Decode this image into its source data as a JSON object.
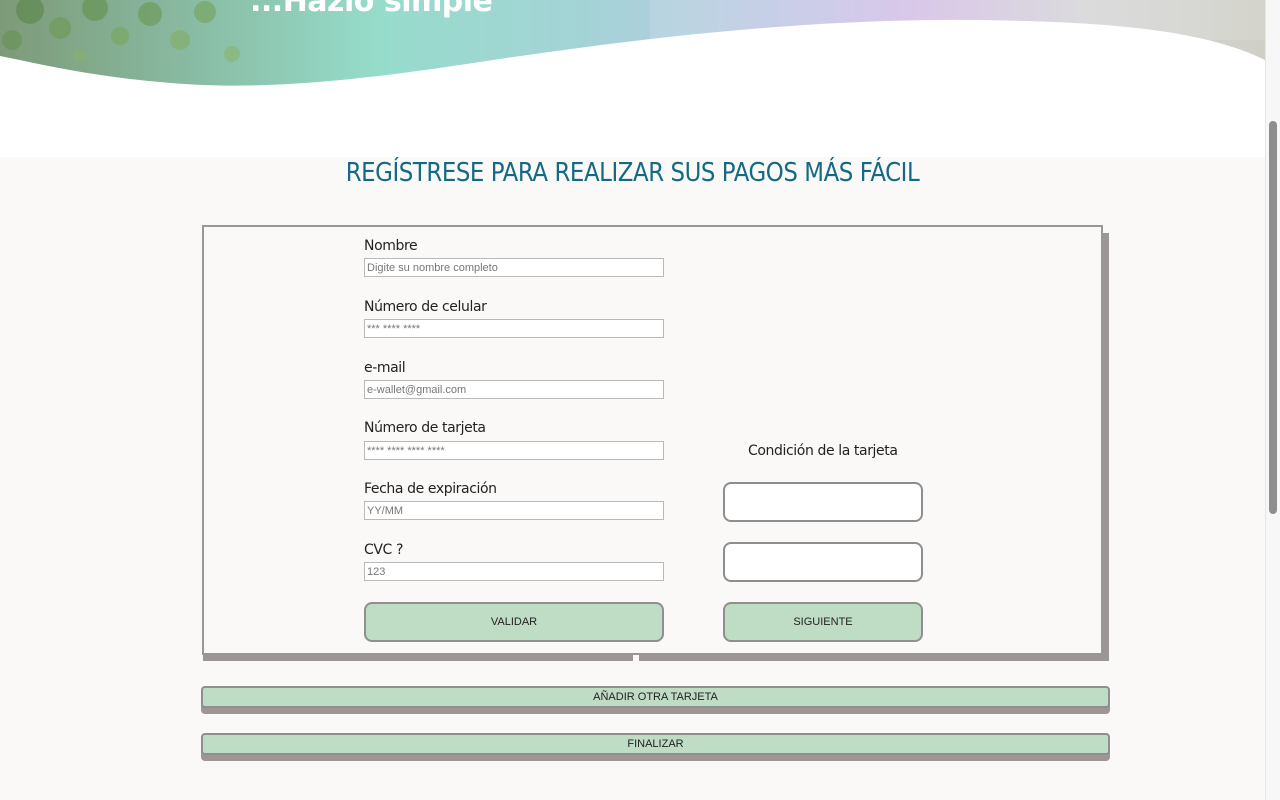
{
  "hero": {
    "tagline": "...Hazlo simple"
  },
  "section": {
    "title": "REGÍSTRESE PARA REALIZAR SUS PAGOS MÁS FÁCIL"
  },
  "form": {
    "fields": [
      {
        "label": "Nombre",
        "placeholder": "Digite su nombre completo",
        "value": ""
      },
      {
        "label": "Número de celular",
        "placeholder": "*** **** ****",
        "value": ""
      },
      {
        "label": "e-mail",
        "placeholder": "e-wallet@gmail.com",
        "value": ""
      },
      {
        "label": "Número de tarjeta",
        "placeholder": "**** **** **** ****",
        "value": ""
      },
      {
        "label": "Fecha de expiración",
        "placeholder": "YY/MM",
        "value": ""
      },
      {
        "label": "CVC ?",
        "placeholder": "123",
        "value": ""
      }
    ],
    "card_condition_label": "Condición de la tarjeta",
    "validate_label": "VALIDAR",
    "next_label": "SIGUIENTE"
  },
  "actions": {
    "add_card_label": "AÑADIR OTRA TARJETA",
    "finish_label": "FINALIZAR"
  },
  "colors": {
    "title": "#136a82",
    "button_fill": "#bfdcc5",
    "shadow": "#9e9695",
    "page_bg": "#faf9f7"
  }
}
